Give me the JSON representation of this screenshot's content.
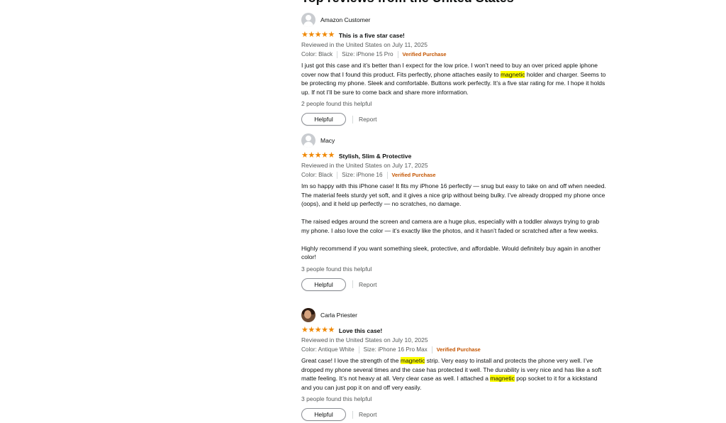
{
  "section_title": "Top reviews from the United States",
  "colors": {
    "star": "#f08804",
    "verified": "#c45500",
    "highlight": "#ffff00",
    "muted": "#565959"
  },
  "reviews": [
    {
      "author": "Amazon Customer",
      "avatar_icon": "default-avatar-icon",
      "stars": "★★★★★",
      "rating": 5,
      "title": "This is a five star case!",
      "date": "Reviewed in the United States on July 11, 2025",
      "color": "Color: Black",
      "size": "Size: iPhone 15 Pro",
      "verified": "Verified Purchase",
      "body": {
        "p1a": "I just got this case and it’s better than I expect for the low price. I won’t need to buy an over priced apple iphone cover now that I found this product. Fits perfectly, phone attaches easily to ",
        "hl1": "magnetic",
        "p1b": " holder and charger. Seems to be protecting my phone. Sleek and comfortable. Buttons work perfectly. It’s a five star rating for me. I hope it holds up. If not I’ll be sure to come back and share more information."
      },
      "helpful_count": "2 people found this helpful",
      "helpful_label": "Helpful",
      "report_label": "Report"
    },
    {
      "author": "Macy",
      "avatar_icon": "default-avatar-icon",
      "stars": "★★★★★",
      "rating": 5,
      "title": "Stylish, Slim & Protective",
      "date": "Reviewed in the United States on July 17, 2025",
      "color": "Color: Black",
      "size": "Size: iPhone 16",
      "verified": "Verified Purchase",
      "body": {
        "p1": "Im so happy with this iPhone case! It fits my iPhone 16 perfectly — snug but easy to take on and off when needed. The material feels sturdy yet soft, and it gives a nice grip without being bulky. I’ve already dropped my phone once (oops), and it held up perfectly — no scratches, no damage.",
        "p2": "The raised edges around the screen and camera are a huge plus, especially with a toddler always trying to grab my phone. I also love the color — it’s exactly like the photos, and it hasn’t faded or scratched after a few weeks.",
        "p3": "Highly recommend if you want something sleek, protective, and affordable. Would definitely buy again in another color!"
      },
      "helpful_count": "3 people found this helpful",
      "helpful_label": "Helpful",
      "report_label": "Report"
    },
    {
      "author": "Carla Priester",
      "avatar_icon": "profile-photo-avatar",
      "stars": "★★★★★",
      "rating": 5,
      "title": "Love this case!",
      "date": "Reviewed in the United States on July 10, 2025",
      "color": "Color: Antique White",
      "size": "Size: iPhone 16 Pro Max",
      "verified": "Verified Purchase",
      "body": {
        "s1": "Great case! I love the strength of the ",
        "hl1": "magnetic",
        "s2": " strip. Very easy to install and protects the phone very well. I’ve dropped my phone several times and the case has protected it well. The durability is very nice and has like a soft matte feeling. It’s not heavy at all. Very clear case as well. I attached a ",
        "hl2": "magnetic",
        "s3": " pop socket to it for a kickstand and you can just pop it on and off very easily."
      },
      "helpful_count": "3 people found this helpful",
      "helpful_label": "Helpful",
      "report_label": "Report"
    }
  ]
}
